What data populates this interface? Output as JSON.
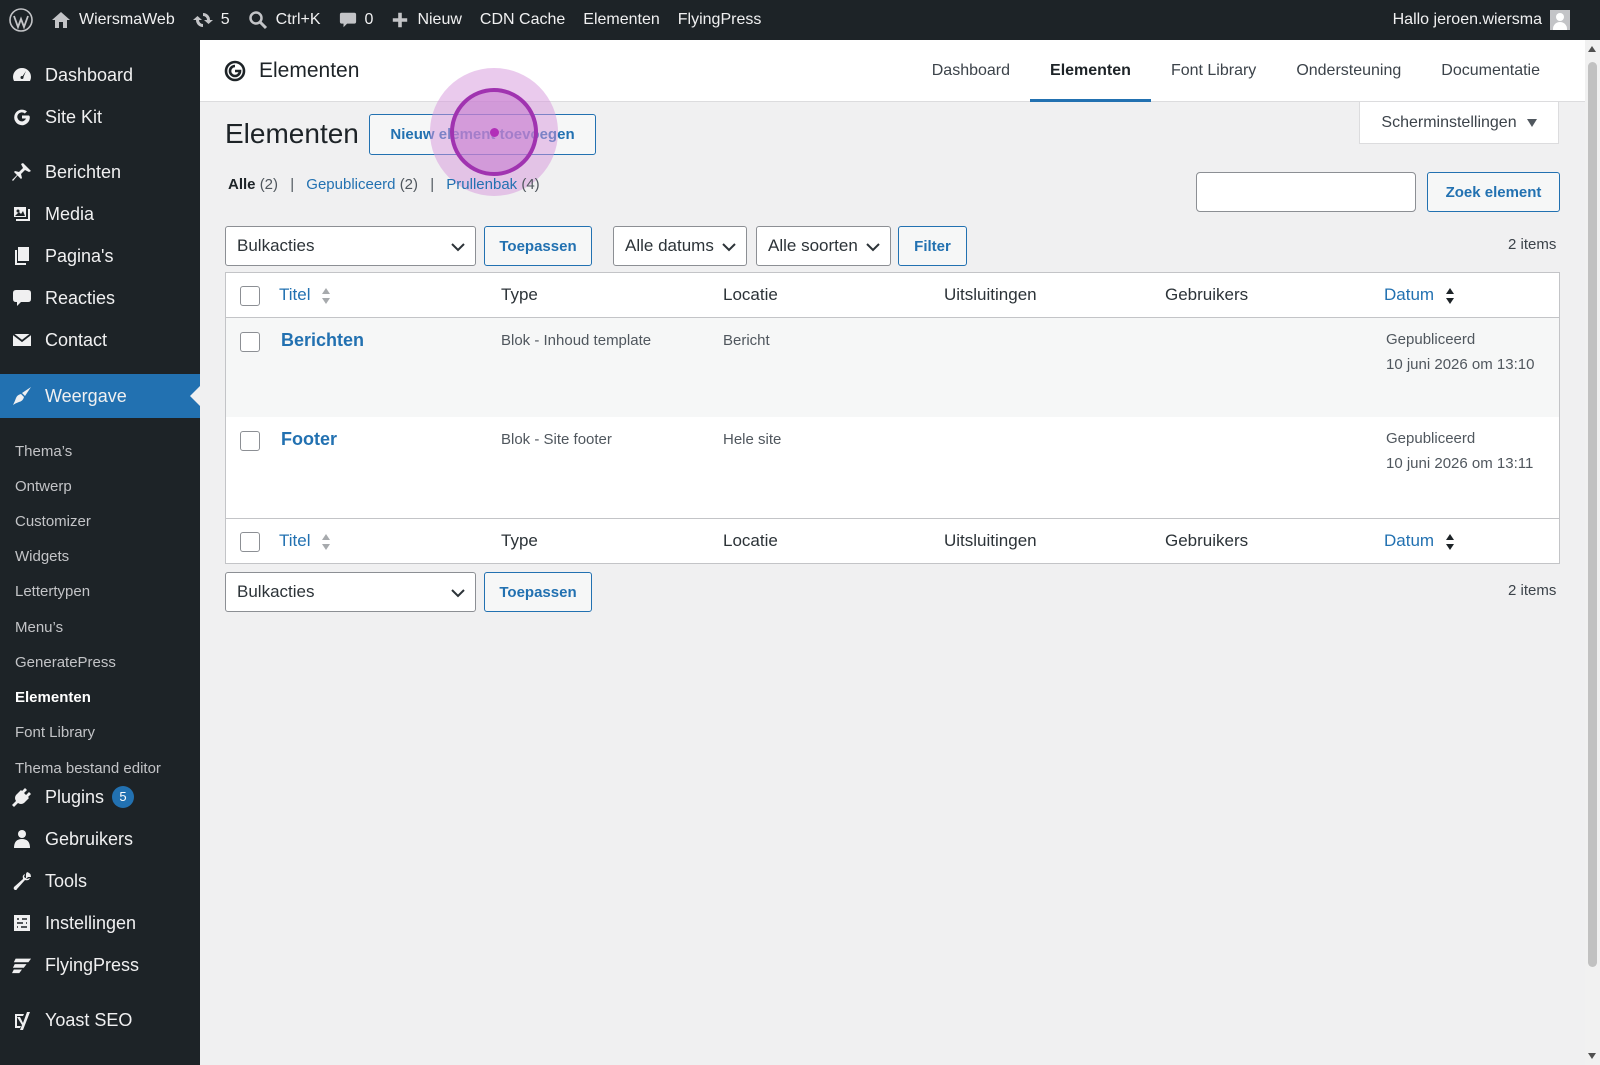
{
  "adminbar": {
    "site_name": "WiersmaWeb",
    "updates_count": "5",
    "search_shortcut": "Ctrl+K",
    "comments_count": "0",
    "new_label": "Nieuw",
    "cdn_cache": "CDN Cache",
    "elementen": "Elementen",
    "flyingpress": "FlyingPress",
    "greeting": "Hallo jeroen.wiersma"
  },
  "sidebar": {
    "items": [
      {
        "label": "Dashboard",
        "icon": "dashboard-icon"
      },
      {
        "label": "Site Kit",
        "icon": "google-g-icon"
      },
      {
        "label": "Berichten",
        "icon": "pushpin-icon"
      },
      {
        "label": "Media",
        "icon": "media-icon"
      },
      {
        "label": "Pagina's",
        "icon": "pages-icon"
      },
      {
        "label": "Reacties",
        "icon": "comment-icon"
      },
      {
        "label": "Contact",
        "icon": "envelope-icon"
      },
      {
        "label": "Weergave",
        "icon": "paintbrush-icon"
      },
      {
        "label": "Plugins",
        "icon": "plugin-icon",
        "badge": "5"
      },
      {
        "label": "Gebruikers",
        "icon": "users-icon"
      },
      {
        "label": "Tools",
        "icon": "wrench-icon"
      },
      {
        "label": "Instellingen",
        "icon": "settings-icon"
      },
      {
        "label": "FlyingPress",
        "icon": "flyingpress-icon"
      },
      {
        "label": "Yoast SEO",
        "icon": "yoast-icon"
      }
    ],
    "submenu": [
      "Thema’s",
      "Ontwerp",
      "Customizer",
      "Widgets",
      "Lettertypen",
      "Menu’s",
      "GeneratePress",
      "Elementen",
      "Font Library",
      "Thema bestand editor"
    ]
  },
  "header": {
    "title": "Elementen",
    "tabs": [
      "Dashboard",
      "Elementen",
      "Font Library",
      "Ondersteuning",
      "Documentatie"
    ]
  },
  "screen_options": "Scherminstellingen",
  "page": {
    "title": "Elementen",
    "add_new": "Nieuw element toevoegen"
  },
  "views": {
    "all": "Alle",
    "all_count": "(2)",
    "published": "Gepubliceerd",
    "published_count": "(2)",
    "trash": "Prullenbak",
    "trash_count": "(4)"
  },
  "search": {
    "button": "Zoek element",
    "value": ""
  },
  "tablenav": {
    "bulk_actions": "Bulkacties",
    "apply": "Toepassen",
    "all_dates": "Alle datums",
    "all_types": "Alle soorten",
    "filter": "Filter",
    "items_count": "2 items"
  },
  "table": {
    "columns": [
      "Titel",
      "Type",
      "Locatie",
      "Uitsluitingen",
      "Gebruikers",
      "Datum"
    ],
    "rows": [
      {
        "title": "Berichten",
        "type": "Blok - Inhoud template",
        "location": "Bericht",
        "exclusions": "",
        "users": "",
        "status": "Gepubliceerd",
        "date": "10 juni 2026 om 13:10"
      },
      {
        "title": "Footer",
        "type": "Blok - Site footer",
        "location": "Hele site",
        "exclusions": "",
        "users": "",
        "status": "Gepubliceerd",
        "date": "10 juni 2026 om 13:11"
      }
    ]
  },
  "colors": {
    "admin_dark": "#1d2327",
    "accent": "#2271b1",
    "click_indicator": "#a033b0"
  }
}
